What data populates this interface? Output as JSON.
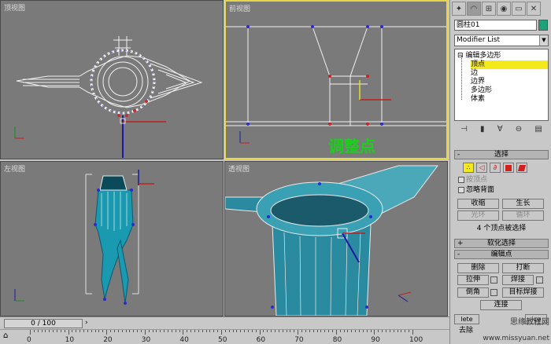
{
  "viewports": {
    "top": {
      "label": "顶视图"
    },
    "front": {
      "label": "前视图",
      "annotation": "调整点"
    },
    "left": {
      "label": "左视图"
    },
    "perspective": {
      "label": "透视图"
    }
  },
  "command_panel": {
    "object_name": "圆柱01",
    "object_color": "#1aa27a",
    "modifier_list": "Modifier List",
    "stack": [
      {
        "label": "编辑多边形",
        "prefix": "⊟",
        "selected": false
      },
      {
        "label": "顶点",
        "selected": true
      },
      {
        "label": "边",
        "selected": false
      },
      {
        "label": "边界",
        "selected": false
      },
      {
        "label": "多边形",
        "selected": false
      },
      {
        "label": "体素",
        "selected": false
      }
    ],
    "selection": {
      "title": "选择",
      "by_vertex": "按顶点",
      "ignore_backfacing": "忽略背面",
      "shrink": "收缩",
      "grow": "生长",
      "ring": "光环",
      "loop": "循环",
      "status": "4 个顶点被选择"
    },
    "soft_selection": {
      "title": "软化选择"
    },
    "edit_vertices": {
      "title": "编辑点",
      "remove": "删除",
      "break": "打断",
      "extrude": "拉伸",
      "weld": "焊接",
      "chamfer": "倒角",
      "target_weld": "目标焊接",
      "connect": "连接",
      "remove_isolated_a": "lete",
      "remove_isolated_b": "ice",
      "remove_unused": "去除"
    }
  },
  "timeline": {
    "frame": "0 / 100",
    "ticks": [
      "0",
      "10",
      "20",
      "30",
      "40",
      "50",
      "60",
      "70",
      "80",
      "90",
      "100"
    ]
  },
  "watermark": {
    "line1": "思缘教程网",
    "line2": "www.missyuan.net"
  }
}
